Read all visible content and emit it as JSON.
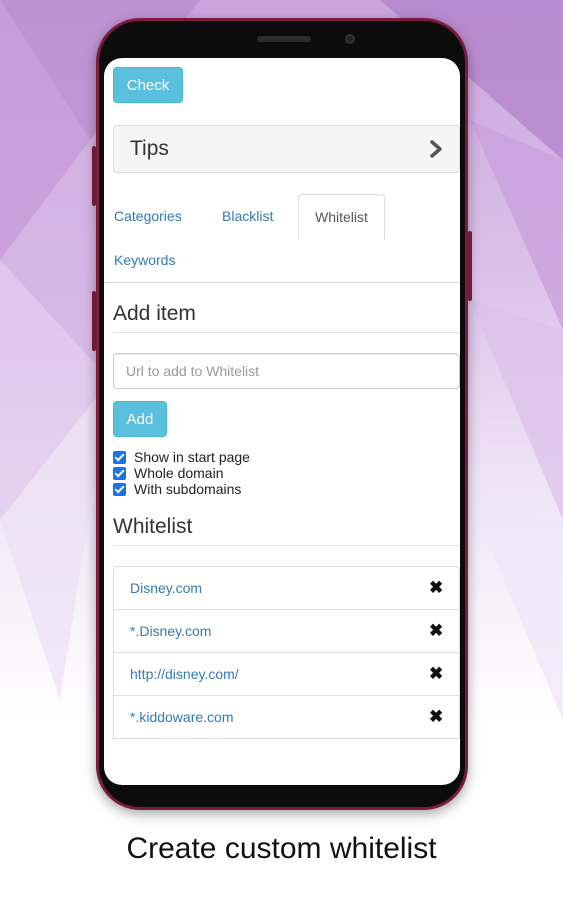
{
  "toolbar": {
    "check_label": "Check"
  },
  "tips": {
    "title": "Tips"
  },
  "tabs": [
    {
      "label": "Categories",
      "active": false
    },
    {
      "label": "Blacklist",
      "active": false
    },
    {
      "label": "Whitelist",
      "active": true
    },
    {
      "label": "Keywords",
      "active": false
    }
  ],
  "add_item": {
    "title": "Add item",
    "url_placeholder": "Url to add to Whitelist",
    "url_value": "",
    "add_label": "Add"
  },
  "options": [
    {
      "label": "Show in start page",
      "checked": true
    },
    {
      "label": "Whole domain",
      "checked": true
    },
    {
      "label": "With subdomains",
      "checked": true
    }
  ],
  "whitelist": {
    "title": "Whitelist",
    "items": [
      {
        "url": "Disney.com",
        "remove_icon": "close-icon"
      },
      {
        "url": "*.Disney.com",
        "remove_icon": "close-icon"
      },
      {
        "url": "http://disney.com/",
        "remove_icon": "close-icon"
      },
      {
        "url": "*.kiddoware.com",
        "remove_icon": "close-icon"
      }
    ]
  },
  "caption": "Create custom whitelist",
  "colors": {
    "accent": "#5bc0de",
    "link": "#337ab7",
    "checkbox": "#1a73e8",
    "phone_frame": "#7a1c3f",
    "background_purple": "#c9a4dc"
  }
}
